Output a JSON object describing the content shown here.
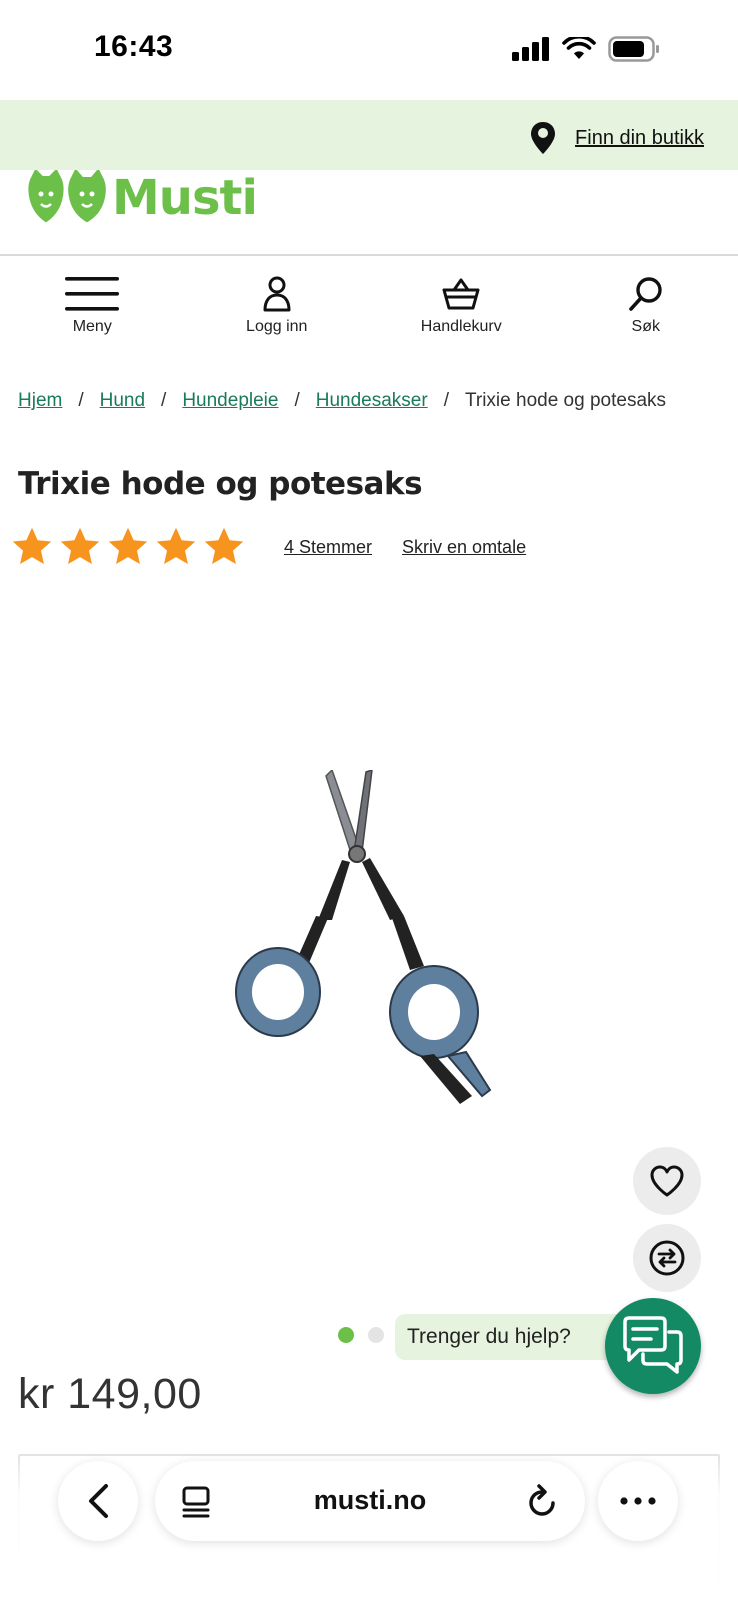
{
  "status_bar": {
    "time": "16:43"
  },
  "store_bar": {
    "link_label": "Finn din butikk",
    "icon": "location-pin-icon"
  },
  "logo": {
    "text": "Musti"
  },
  "nav": [
    {
      "label": "Meny",
      "icon": "menu-icon"
    },
    {
      "label": "Logg inn",
      "icon": "user-icon"
    },
    {
      "label": "Handlekurv",
      "icon": "basket-icon"
    },
    {
      "label": "Søk",
      "icon": "search-icon"
    }
  ],
  "breadcrumb": {
    "items": [
      "Hjem",
      "Hund",
      "Hundepleie",
      "Hundesakser"
    ],
    "current": "Trixie hode og potesaks"
  },
  "product": {
    "title": "Trixie hode og potesaks",
    "rating": 5,
    "rating_max": 5,
    "votes_label": "4 Stemmer",
    "review_label": "Skriv en omtale",
    "price": "kr 149,00",
    "image_count": 2,
    "image_active_index": 0
  },
  "help": {
    "label": "Trenger du hjelp?"
  },
  "browser": {
    "url": "musti.no"
  },
  "colors": {
    "brand_green": "#6cc04a",
    "link_green": "#1a7a5c",
    "chat_green": "#138a63",
    "store_bar_bg": "#e6f4df",
    "star": "#f7941d"
  }
}
